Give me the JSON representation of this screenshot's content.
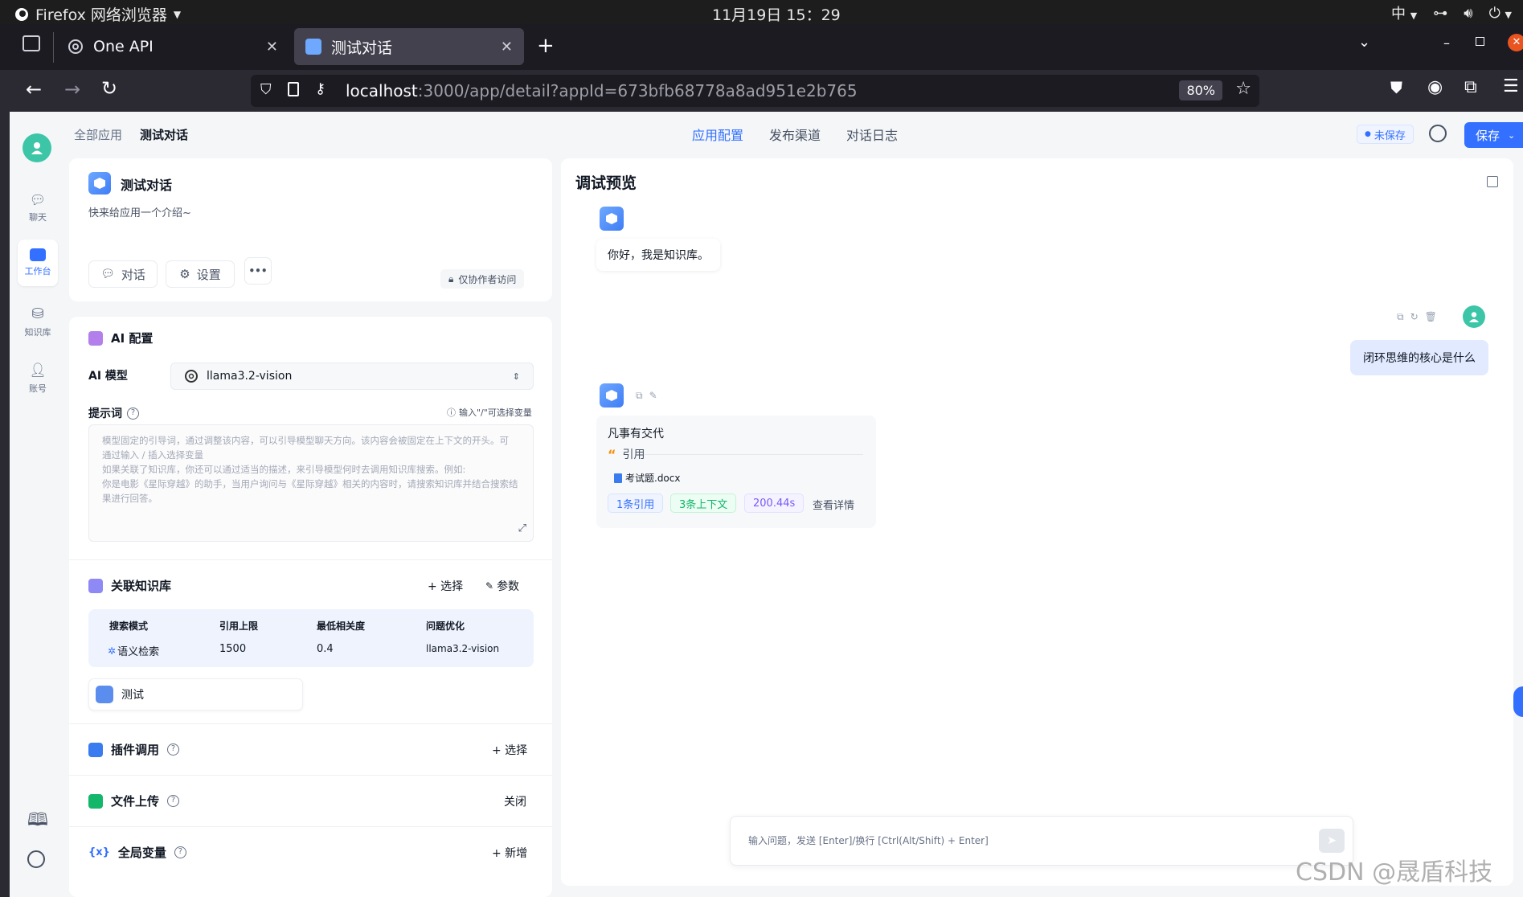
{
  "os": {
    "app_name": "Firefox 网络浏览器",
    "clock": "11月19日  15：29",
    "input_method": "中"
  },
  "browser": {
    "tabs": [
      {
        "title": "One API",
        "active": false
      },
      {
        "title": "测试对话",
        "active": true
      }
    ],
    "url_host": "localhost",
    "url_rest": ":3000/app/detail?appId=673bfb68778a8ad951e2b765",
    "zoom": "80%"
  },
  "sidebar": {
    "items": [
      {
        "label": "聊天",
        "icon": "chat-icon"
      },
      {
        "label": "工作台",
        "icon": "robot-icon",
        "active": true
      },
      {
        "label": "知识库",
        "icon": "database-icon"
      },
      {
        "label": "账号",
        "icon": "user-icon"
      }
    ]
  },
  "header": {
    "breadcrumb": [
      "全部应用",
      "测试对话"
    ],
    "tabs": [
      "应用配置",
      "发布渠道",
      "对话日志"
    ],
    "active_tab": "应用配置",
    "unsaved": "未保存",
    "save": "保存"
  },
  "app_card": {
    "name": "测试对话",
    "intro": "快来给应用一个介绍~",
    "chat_button": "对话",
    "settings_button": "设置",
    "more_button": "•••",
    "access": "仅协作者访问"
  },
  "ai_config": {
    "title": "AI 配置",
    "model_label": "AI 模型",
    "model_value": "llama3.2-vision",
    "prompt_label": "提示词",
    "prompt_hint": "输入\"/\"可选择变量",
    "prompt_placeholder": [
      "模型固定的引导词，通过调整该内容，可以引导模型聊天方向。该内容会被固定在上下文的开头。可",
      "通过输入 / 插入选择变量",
      "如果关联了知识库，你还可以通过适当的描述，来引导模型何时去调用知识库搜索。例如:",
      "你是电影《星际穿越》的助手，当用户询问与《星际穿越》相关的内容时，请搜索知识库并结合搜索结",
      "果进行回答。"
    ]
  },
  "kb": {
    "title": "关联知识库",
    "select": "+ 选择",
    "params": "参数",
    "table_headers": [
      "搜索模式",
      "引用上限",
      "最低相关度",
      "问题优化"
    ],
    "table_values": [
      "语义检索",
      "1500",
      "0.4",
      "llama3.2-vision"
    ],
    "dataset_name": "测试"
  },
  "plugins": {
    "title": "插件调用",
    "action": "+ 选择"
  },
  "file_upload": {
    "title": "文件上传",
    "action": "关闭"
  },
  "global_vars": {
    "title": "全局变量",
    "action": "+ 新增"
  },
  "preview": {
    "title": "调试预览",
    "welcome": "你好，我是知识库。",
    "user_message": "闭环思维的核心是什么",
    "bot_answer": "凡事有交代",
    "quote_label": "引用",
    "file_name": "考试题.docx",
    "chips": [
      "1条引用",
      "3条上下文",
      "200.44s"
    ],
    "detail_link": "查看详情",
    "input_placeholder": "输入问题，发送 [Enter]/换行 [Ctrl(Alt/Shift) + Enter]"
  },
  "watermark": "CSDN @晟盾科技",
  "colors": {
    "accent": "#3370ff",
    "page_bg": "#f4f6f8",
    "user_bubble": "#e1eaff",
    "chip_blue": "#3370ff",
    "chip_green": "#12b76a",
    "chip_purple": "#7a5af8"
  }
}
